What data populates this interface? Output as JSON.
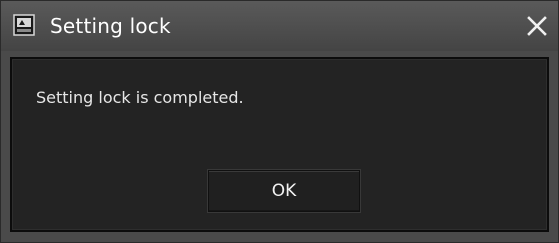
{
  "window": {
    "title": "Setting lock",
    "app_icon": "app-window-icon",
    "close_icon": "close-icon"
  },
  "dialog": {
    "message": "Setting lock is completed.",
    "ok_label": "OK"
  },
  "colors": {
    "titlebar": "#4a4a4a",
    "client_background": "#232323",
    "text": "#e6e6e6"
  }
}
